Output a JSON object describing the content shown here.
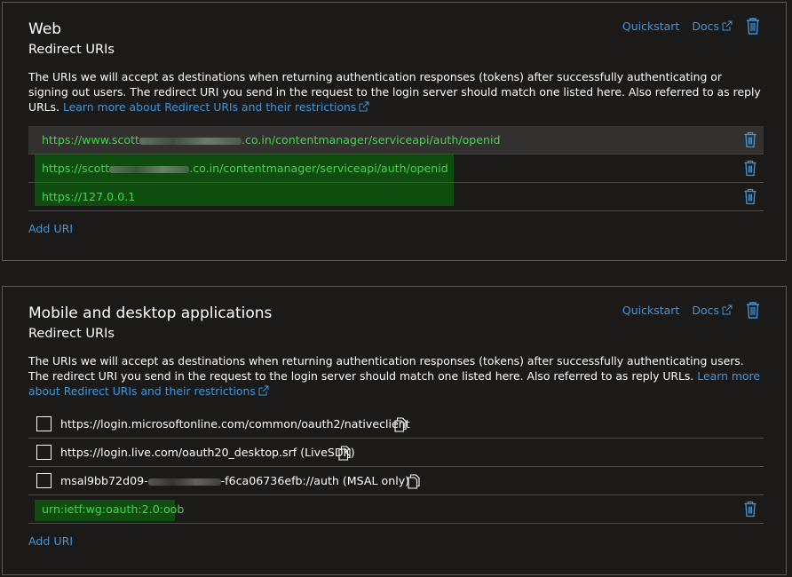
{
  "colors": {
    "link": "#3a96dd",
    "highlight_text": "#3dd84a",
    "highlight_bg": "#0f4d0f",
    "background": "#1b1a19",
    "border": "#5c5b5a"
  },
  "web": {
    "title": "Web",
    "subtitle": "Redirect URIs",
    "quickstart": "Quickstart",
    "docs": "Docs",
    "description": "The URIs we will accept as destinations when returning authentication responses (tokens) after successfully authenticating or signing out users. The redirect URI you send in the request to the login server should match one listed here. Also referred to as reply URLs.",
    "learn_more": "Learn more about Redirect URIs and their restrictions",
    "uris": [
      {
        "prefix": "https://www.scott",
        "suffix": ".co.in/contentmanager/serviceapi/auth/openid"
      },
      {
        "prefix": "https://scott",
        "suffix": ".co.in/contentmanager/serviceapi/auth/openid"
      },
      {
        "prefix": "https://127.0.0.1",
        "suffix": ""
      }
    ],
    "add_uri": "Add URI"
  },
  "mobile": {
    "title": "Mobile and desktop applications",
    "subtitle": "Redirect URIs",
    "quickstart": "Quickstart",
    "docs": "Docs",
    "description": "The URIs we will accept as destinations when returning authentication responses (tokens) after successfully authenticating users. The redirect URI you send in the request to the login server should match one listed here. Also referred to as reply URLs.",
    "learn_more": "Learn more about Redirect URIs and their restrictions",
    "suggested": [
      {
        "text": "https://login.microsoftonline.com/common/oauth2/nativeclient"
      },
      {
        "text": "https://login.live.com/oauth20_desktop.srf (LiveSDK)"
      },
      {
        "prefix": "msal9bb72d09-",
        "suffix": "-f6ca06736efb://auth (MSAL only)"
      }
    ],
    "custom_uri": "urn:ietf:wg:oauth:2.0:oob",
    "add_uri": "Add URI"
  }
}
